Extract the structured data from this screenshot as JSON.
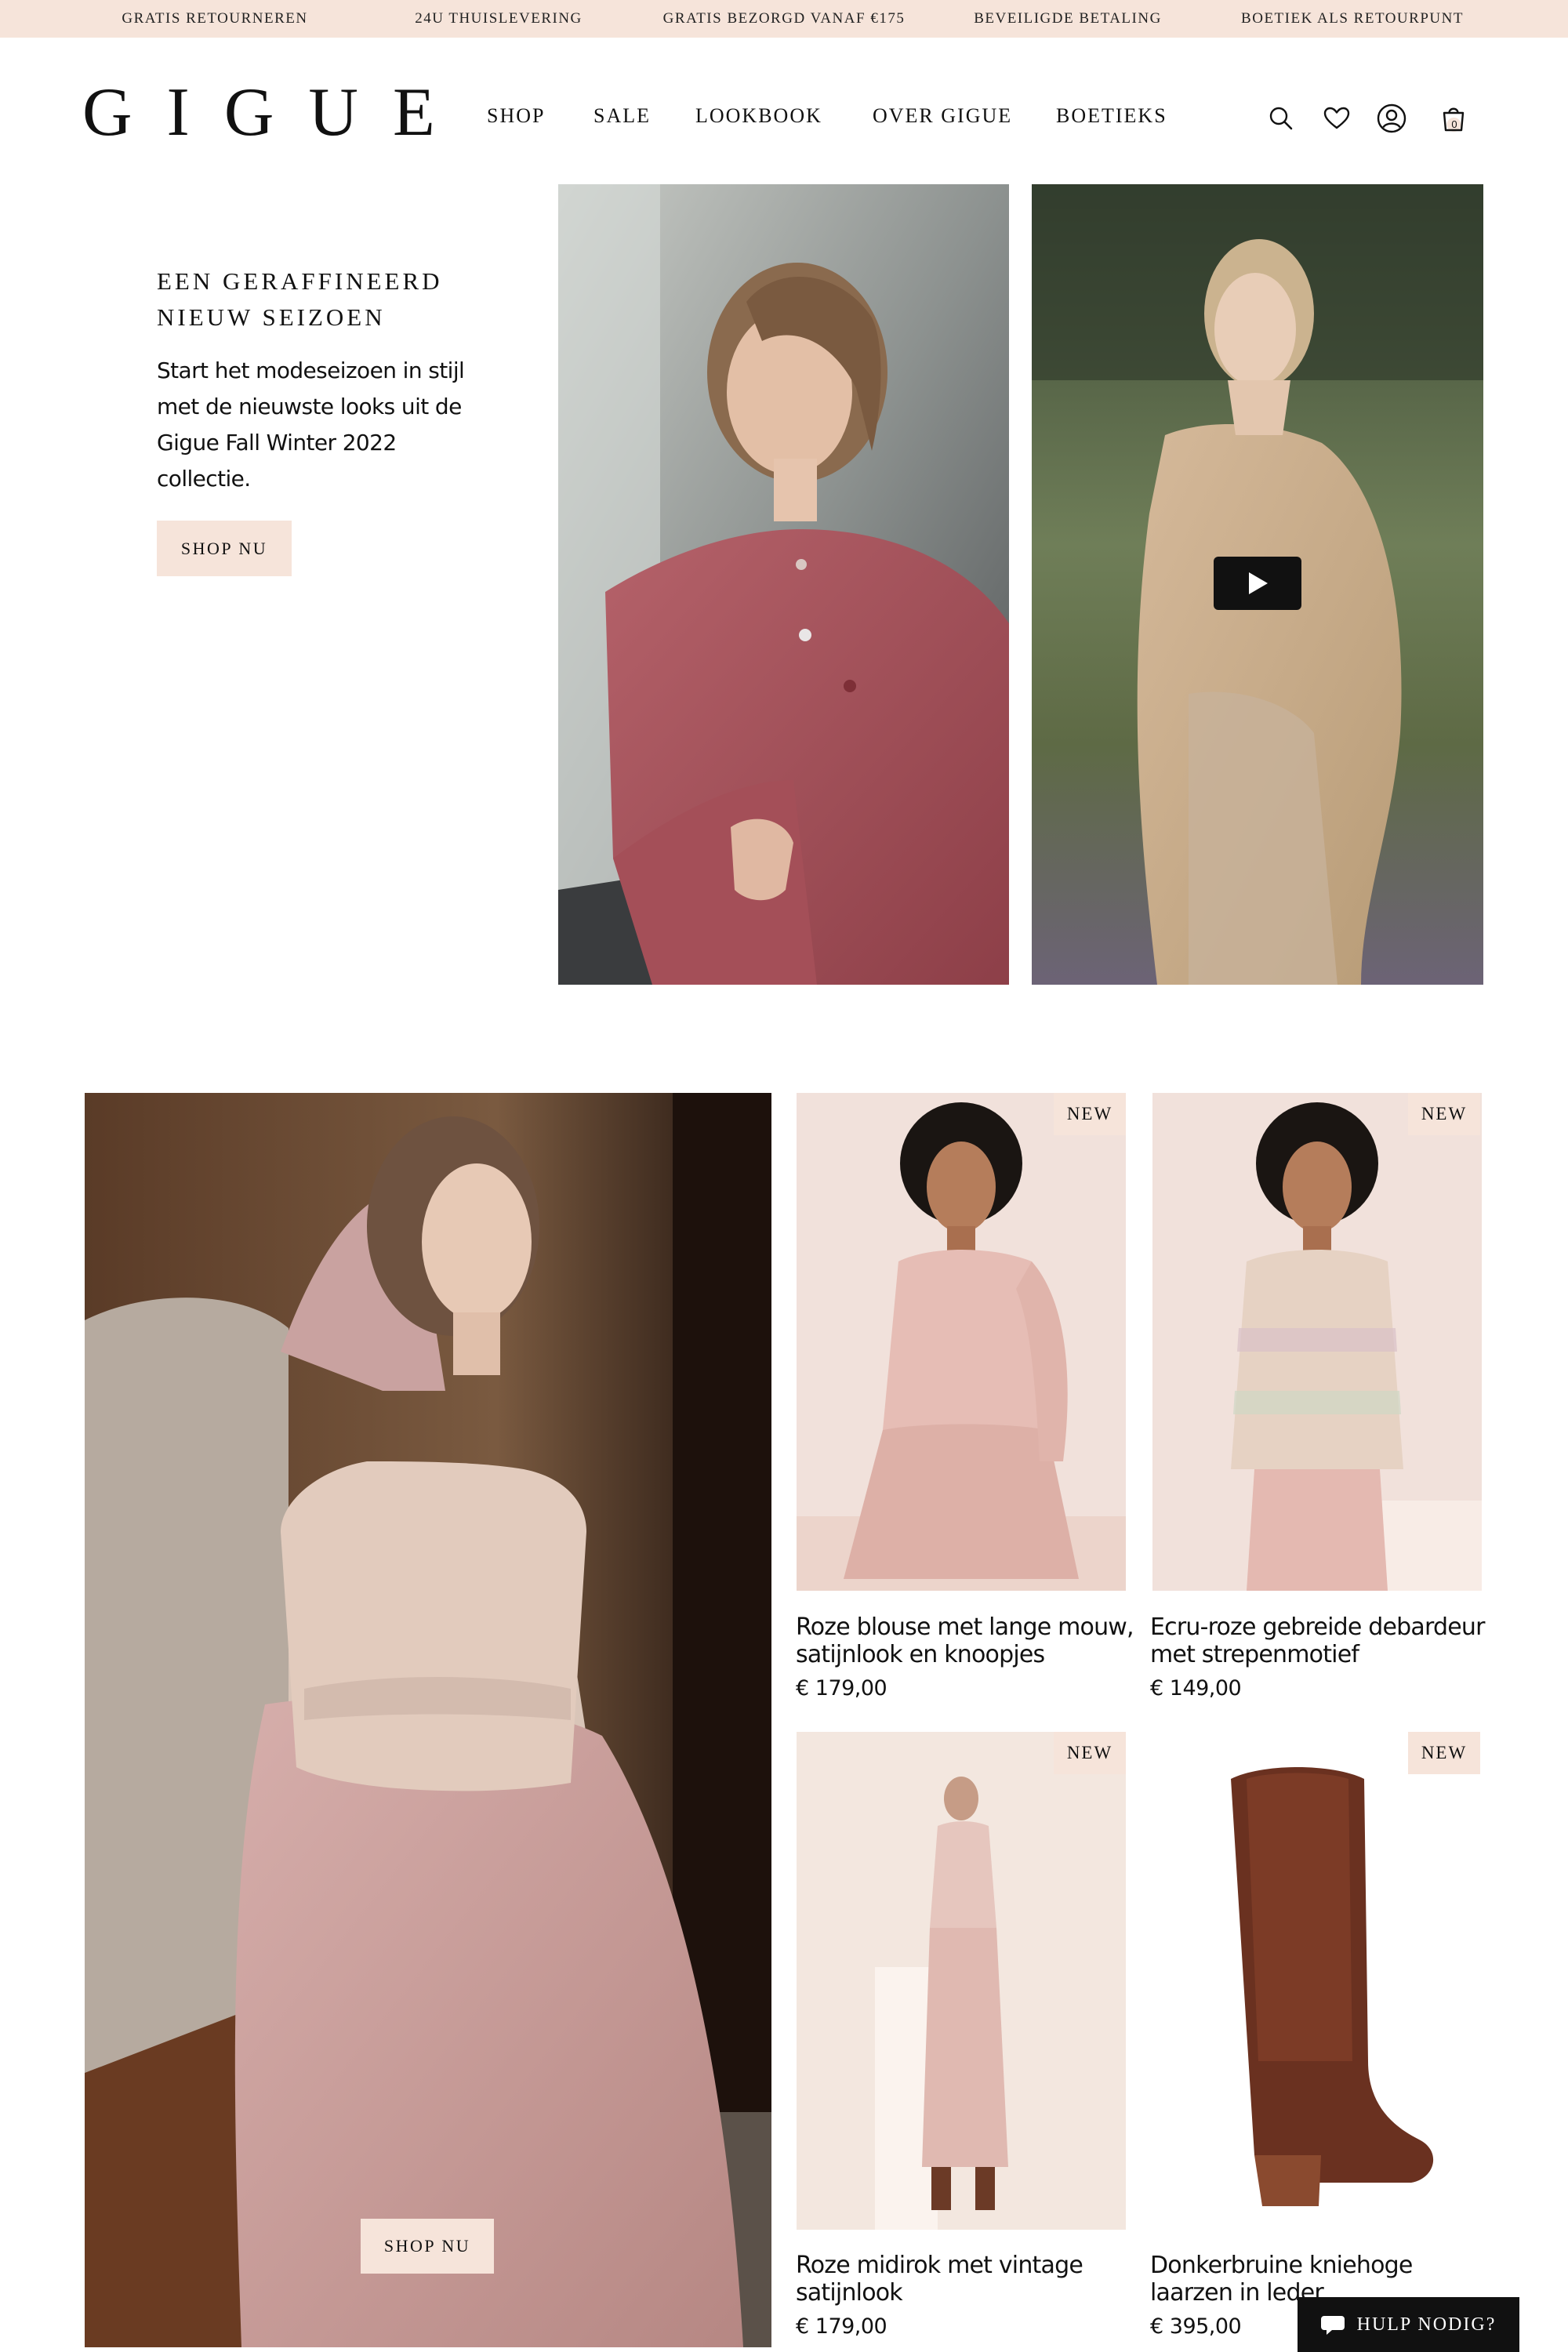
{
  "announcement": {
    "items": [
      "GRATIS RETOURNEREN",
      "24U THUISLEVERING",
      "GRATIS BEZORGD VANAF €175",
      "BEVEILIGDE BETALING",
      "BOETIEK ALS RETOURPUNT"
    ]
  },
  "header": {
    "logo": "GIGUE",
    "nav": [
      "SHOP",
      "SALE",
      "LOOKBOOK",
      "OVER GIGUE",
      "BOETIEKS"
    ],
    "icons": [
      "search-icon",
      "heart-icon",
      "account-icon",
      "bag-icon"
    ],
    "cart_count": "0"
  },
  "hero": {
    "title": "EEN GERAFFINEERD NIEUW SEIZOEN",
    "text": "Start het modeseizoen in stijl met de nieuwste looks uit de Gigue Fall Winter 2022 collectie.",
    "cta": "SHOP NU"
  },
  "feature": {
    "cta": "SHOP NU"
  },
  "products": [
    {
      "name": "Roze blouse met lange mouw, satijnlook en knoopjes",
      "price": "€ 179,00",
      "badge": "NEW"
    },
    {
      "name": "Ecru-roze gebreide debardeur met strepenmotief",
      "price": "€ 149,00",
      "badge": "NEW"
    },
    {
      "name": "Roze midirok met vintage satijnlook",
      "price": "€ 179,00",
      "badge": "NEW"
    },
    {
      "name": "Donkerbruine kniehoge laarzen in leder",
      "price": "€ 395,00",
      "badge": "NEW"
    }
  ],
  "help": {
    "label": "HULP NODIG?"
  },
  "colors": {
    "accent_peach": "#f6e4da",
    "text": "#111111",
    "help_bg": "#111111"
  }
}
